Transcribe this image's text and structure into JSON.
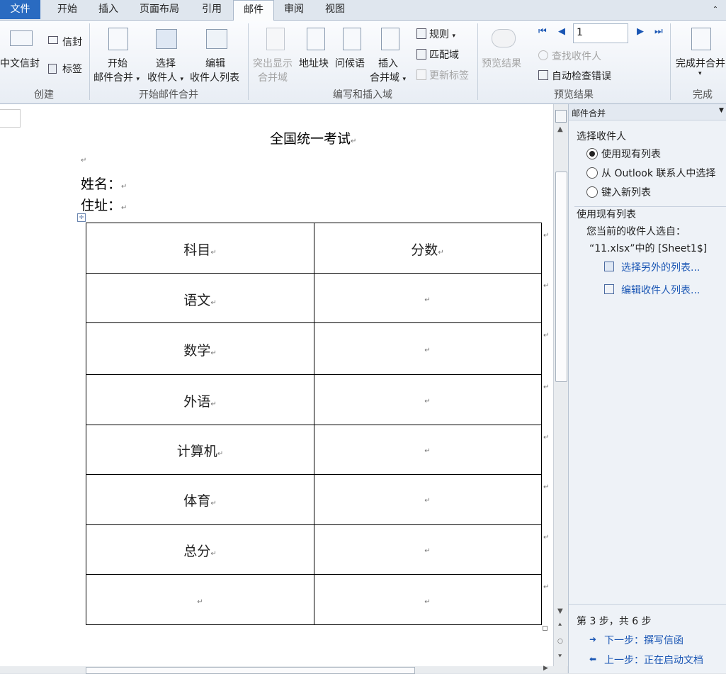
{
  "tabs": [
    "文件",
    "开始",
    "插入",
    "页面布局",
    "引用",
    "邮件",
    "审阅",
    "视图"
  ],
  "ribbon": {
    "create": {
      "chinese_envelope": "中文信封",
      "envelope": "信封",
      "labels": "标签",
      "group": "创建"
    },
    "start_merge": {
      "start_line1": "开始",
      "start_line2": "邮件合并",
      "select_line1": "选择",
      "select_line2": "收件人",
      "edit_line1": "编辑",
      "edit_line2": "收件人列表",
      "group": "开始邮件合并"
    },
    "write_insert": {
      "highlight_line1": "突出显示",
      "highlight_line2": "合并域",
      "address_block": "地址块",
      "greeting_line": "问候语",
      "insert_line1": "插入",
      "insert_line2": "合并域",
      "rules": "规则",
      "match_fields": "匹配域",
      "update_labels": "更新标签",
      "group": "编写和插入域"
    },
    "preview": {
      "preview_results": "预览结果",
      "record_value": "1",
      "find_recipient": "查找收件人",
      "auto_check": "自动检查错误",
      "group": "预览结果"
    },
    "finish": {
      "finish_merge": "完成并合并",
      "group": "完成"
    }
  },
  "document": {
    "title": "全国统一考试",
    "name_label": "姓名：",
    "address_label": "住址：",
    "table": {
      "headers": [
        "科目",
        "分数"
      ],
      "rows": [
        [
          "语文",
          ""
        ],
        [
          "数学",
          ""
        ],
        [
          "外语",
          ""
        ],
        [
          "计算机",
          ""
        ],
        [
          "体育",
          ""
        ],
        [
          "总分",
          ""
        ],
        [
          "",
          ""
        ]
      ]
    }
  },
  "pane": {
    "title": "邮件合并",
    "select_recipients": "选择收件人",
    "option_existing": "使用现有列表",
    "option_outlook": "从 Outlook 联系人中选择",
    "option_new": "键入新列表",
    "use_existing_heading": "使用现有列表",
    "current_from": "您当前的收件人选自：",
    "source": "“11.xlsx”中的 [Sheet1$]",
    "select_other": "选择另外的列表...",
    "edit_list": "编辑收件人列表...",
    "step": "第 3 步，共 6 步",
    "next": "下一步：撰写信函",
    "prev": "上一步：正在启动文档"
  }
}
